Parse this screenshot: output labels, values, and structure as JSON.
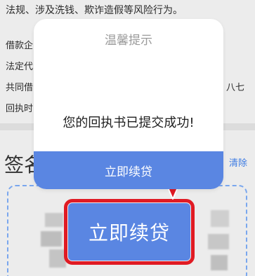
{
  "background": {
    "top_line": "法规、涉及洗钱、欺诈造假等风险行为。",
    "line1": "借款企",
    "line2": "法定代",
    "line3": "共同借",
    "line3_right": "八七",
    "line4": "回执时",
    "sign_heading": "签名",
    "clear_label": "清除"
  },
  "dialog": {
    "title": "温馨提示",
    "message": "您的回执书已提交成功!",
    "button_label": "立即续贷"
  },
  "highlight_button": {
    "label": "立即续贷"
  },
  "colors": {
    "accent_blue": "#5a86e2",
    "highlight_red": "#e01b24",
    "link_blue": "#3d7be3"
  }
}
